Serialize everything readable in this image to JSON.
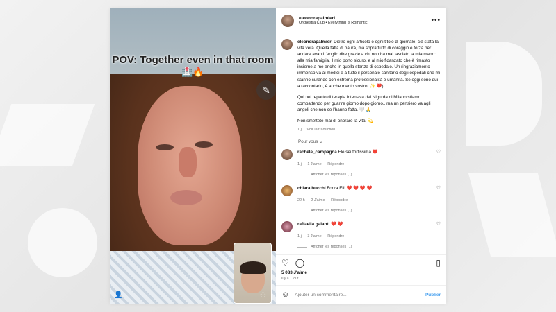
{
  "media": {
    "overlay_caption": "POV: Together even in that room",
    "overlay_emoji": "🏥🔥",
    "edit_icon": "pencil-icon",
    "user_icon": "person-icon",
    "pip_icon": "people-icon"
  },
  "header": {
    "username": "eleonorapalmieri",
    "subtitle": "Orchestra Club • Everything Is Romantic",
    "more_icon": "more-dots-icon"
  },
  "caption": {
    "username": "eleonorapalmieri",
    "text1": "Dietro ogni articolo e ogni titolo di giornale, c'è stata la vita vera. Quella fatta di paura, ma soprattutto di coraggio e forza per andare avanti. Voglio dire grazie a chi non ha mai lasciato la mia mano: alla mia famiglia, il mio porto sicuro, e al mio fidanzato che è rimasto insieme a me anche in quella stanza di ospedale. Un ringraziamento immenso va ai medici e a tutto il personale sanitario degli ospedali che mi stanno curando con estrema professionalità e umanità. Se oggi sono qui a raccontarlo, è anche merito vostro. ✨ ❤️)",
    "text2": "Qui nel reparto di terapia intensiva del Nigurda di Milano stiamo combattendo per guarire giorno dopo giorno.. ma un pensiero va agli angeli che non ce l'hanno fatta. 🤍 🙏",
    "text3": "Non smettete mai di onorare la vita! 💫",
    "time": "1 j",
    "translate": "Voir la traduction"
  },
  "pour_vous": "Pour vous ⌄",
  "comments": [
    {
      "username": "rachele_campagna",
      "text": "Ele sei fortissima ❤️",
      "time": "1 j",
      "likes": "1 J'aime",
      "reply": "Répondre",
      "replies": "Afficher les réponses (1)"
    },
    {
      "username": "chiara.bucchi",
      "text": "Forza Eli! ❤️ ❤️ ❤️ ❤️",
      "time": "22 h",
      "likes": "2 J'aime",
      "reply": "Répondre",
      "replies": "Afficher les réponses (1)"
    },
    {
      "username": "raffaella.galanti",
      "text": "❤️ ❤️",
      "time": "1 j",
      "likes": "3 J'aime",
      "reply": "Répondre",
      "replies": "Afficher les réponses (1)"
    }
  ],
  "actions": {
    "likes": "5 083 J'aime",
    "time": "Il y a 1 jour"
  },
  "add_comment": {
    "placeholder": "Ajouter un commentaire...",
    "publish": "Publier"
  }
}
